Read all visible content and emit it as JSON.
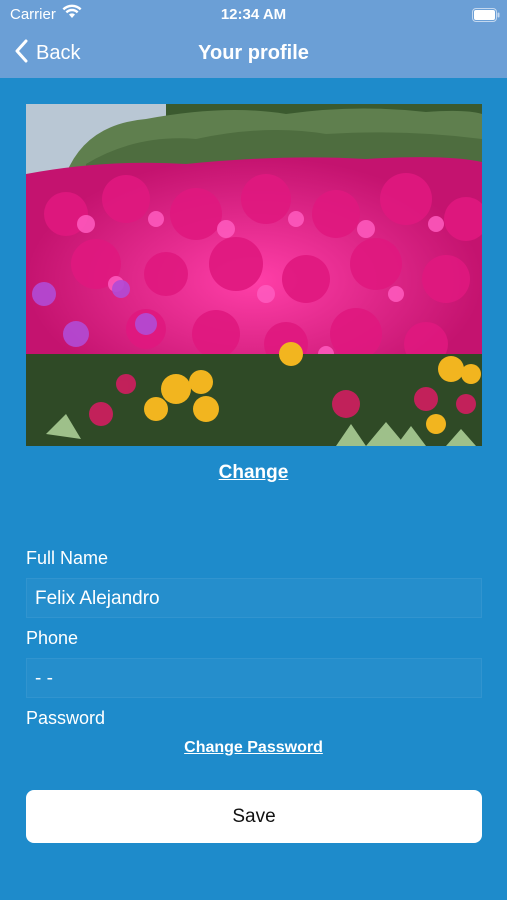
{
  "status_bar": {
    "carrier": "Carrier",
    "time": "12:34 AM"
  },
  "nav": {
    "back_label": "Back",
    "title": "Your profile"
  },
  "profile": {
    "change_photo_label": "Change",
    "full_name_label": "Full Name",
    "full_name_value": "Felix Alejandro",
    "phone_label": "Phone",
    "phone_value": "- -",
    "password_label": "Password",
    "change_password_label": "Change Password",
    "save_label": "Save"
  },
  "colors": {
    "background": "#1e8bcb",
    "nav_bar": "#6b9fd6",
    "button_bg": "#ffffff"
  },
  "icons": [
    "wifi-icon",
    "battery-icon",
    "chevron-left-icon"
  ]
}
